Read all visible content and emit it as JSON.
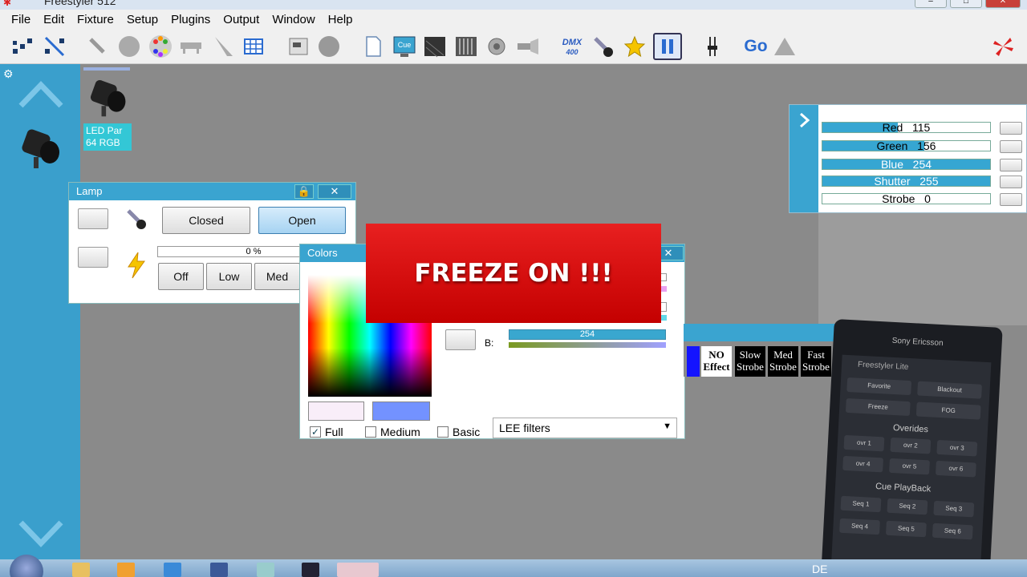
{
  "window": {
    "title": "Freestyler 512"
  },
  "menu": [
    "File",
    "Edit",
    "Fixture",
    "Setup",
    "Plugins",
    "Output",
    "Window",
    "Help"
  ],
  "toolbar": {
    "icons": [
      "patch-icon",
      "unpatch-icon",
      "fixture-icon",
      "gobo-icon",
      "color-wheel-icon",
      "truss-icon",
      "beam-icon",
      "grid-icon",
      "overrides-icon",
      "disc-icon",
      "page-icon",
      "cue-icon",
      "dark-panel-icon",
      "faders-icon",
      "speaker-icon",
      "spotlight-icon",
      "dmx-icon",
      "lamp-icon",
      "star-icon",
      "pause-icon",
      "fader-icon",
      "go-icon",
      "warning-icon",
      "logo-icon"
    ],
    "cue_label": "Cue",
    "dmx_label": "DMX",
    "dmx_sub": "400",
    "go_label": "Go"
  },
  "fixture": {
    "name": "LED Par",
    "sub": "64 RGB"
  },
  "lamp_panel": {
    "title": "Lamp",
    "closed_label": "Closed",
    "open_label": "Open",
    "percent": "0 %",
    "off_label": "Off",
    "low_label": "Low",
    "med_label": "Med"
  },
  "colors_panel": {
    "title": "Colors",
    "b_label": "B:",
    "b_value": "254",
    "full_label": "Full",
    "full_checked": "✓",
    "medium_label": "Medium",
    "basic_label": "Basic",
    "filter_label": "LEE filters",
    "swatch_left": "#f9eef9",
    "swatch_right": "#7392ff"
  },
  "freeze": {
    "text": "FREEZE ON !!!"
  },
  "channels": [
    {
      "name": "Red",
      "value": "115",
      "level": 0.45
    },
    {
      "name": "Green",
      "value": "156",
      "level": 0.61
    },
    {
      "name": "Blue",
      "value": "254",
      "level": 1.0
    },
    {
      "name": "Shutter",
      "value": "255",
      "level": 1.0
    },
    {
      "name": "Strobe",
      "value": "0",
      "level": 0.0
    }
  ],
  "effects": [
    {
      "line1": "NO",
      "line2": "Effect"
    },
    {
      "line1": "Slow",
      "line2": "Strobe"
    },
    {
      "line1": "Med",
      "line2": "Strobe"
    },
    {
      "line1": "Fast",
      "line2": "Strobe"
    }
  ],
  "phone": {
    "brand": "Sony Ericsson",
    "app": "Freestyler Lite",
    "favorite": "Favorite",
    "blackout": "Blackout",
    "freeze": "Freeze",
    "fog": "FOG",
    "overrides": "Overides",
    "ovr": [
      "ovr 1",
      "ovr 2",
      "ovr 3",
      "ovr 4",
      "ovr 5",
      "ovr 6"
    ],
    "cue_playback": "Cue PlayBack",
    "seq": [
      "Seq 1",
      "Seq 2",
      "Seq 3",
      "Seq 4",
      "Seq 5",
      "Seq 6"
    ]
  },
  "taskbar": {
    "lang": "DE"
  }
}
